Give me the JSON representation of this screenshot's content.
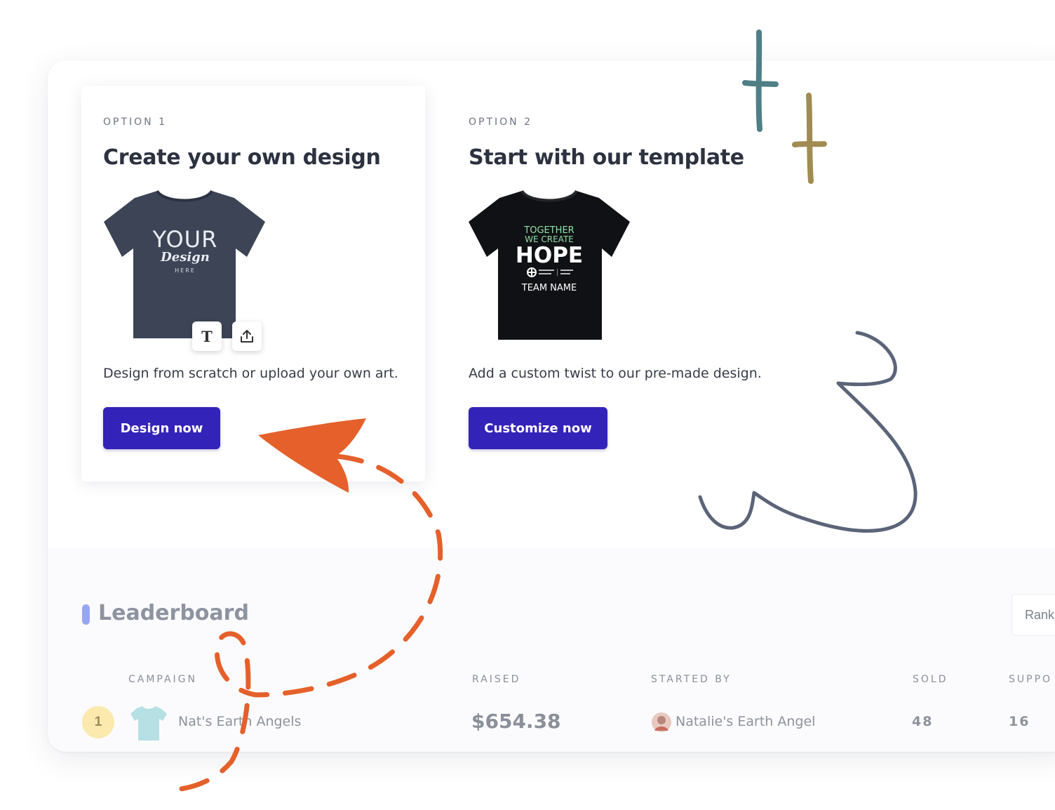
{
  "option1": {
    "kicker": "OPTION 1",
    "title": "Create your own design",
    "description": "Design from scratch or upload your own art.",
    "button_label": "Design now",
    "shirt_text": {
      "line1": "YOUR",
      "line2": "Design",
      "line3": "HERE"
    },
    "text_tool_label": "T"
  },
  "option2": {
    "kicker": "OPTION 2",
    "title": "Start with our template",
    "description": "Add a custom twist to our pre-made design.",
    "button_label": "Customize now",
    "shirt_text": {
      "line1": "TOGETHER",
      "line2": "WE CREATE",
      "line3": "HOPE",
      "line4": "TEAM NAME"
    }
  },
  "leaderboard": {
    "title": "Leaderboard",
    "sort_label": "Rank",
    "columns": [
      "CAMPAIGN",
      "RAISED",
      "STARTED BY",
      "SOLD",
      "SUPPO"
    ],
    "rows": [
      {
        "rank": "1",
        "campaign": "Nat's Earth Angels",
        "raised": "$654.38",
        "started_by": "Natalie's Earth Angel",
        "sold": "48",
        "supporters": "16"
      }
    ]
  },
  "colors": {
    "primary_button": "#3423b8",
    "annotation_orange": "#e5602a",
    "leaderboard_accent": "#98a6f2",
    "doodle_teal": "#4f7f86",
    "doodle_gold": "#a08c52",
    "doodle_slate": "#5b6478"
  }
}
